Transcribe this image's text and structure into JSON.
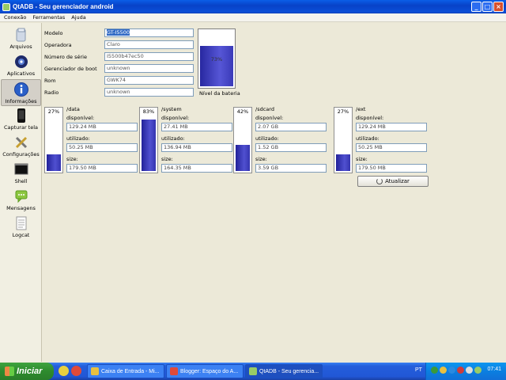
{
  "window": {
    "title": "QtADB - Seu gerenciador android"
  },
  "menu": [
    "Conexão",
    "Ferramentas",
    "Ajuda"
  ],
  "sidebar": {
    "items": [
      {
        "label": "Arquivos",
        "icon": "folder-icon"
      },
      {
        "label": "Aplicativos",
        "icon": "gear-icon"
      },
      {
        "label": "Informações",
        "icon": "info-icon",
        "active": true
      },
      {
        "label": "Capturar tela",
        "icon": "phone-icon"
      },
      {
        "label": "Configurações",
        "icon": "tools-icon"
      },
      {
        "label": "Shell",
        "icon": "terminal-icon"
      },
      {
        "label": "Mensagens",
        "icon": "message-icon"
      },
      {
        "label": "Logcat",
        "icon": "log-icon"
      }
    ]
  },
  "info": {
    "fields": [
      {
        "label": "Modelo",
        "value": "GT-I5500"
      },
      {
        "label": "Operadora",
        "value": "Claro"
      },
      {
        "label": "Número de série",
        "value": "I5500b47ec50"
      },
      {
        "label": "Gerenciador de boot",
        "value": "unknown"
      },
      {
        "label": "Rom",
        "value": "GWK74"
      },
      {
        "label": "Radio",
        "value": "unknown"
      }
    ],
    "battery": {
      "percent_text": "73%",
      "level": 0.73,
      "label": "Nível da bateria"
    }
  },
  "disks": [
    {
      "mount": "/data",
      "percent_text": "27%",
      "used_fraction": 0.27,
      "available_label": "disponível:",
      "available": "129.24 MB",
      "used_label": "utilizado:",
      "used": "50.25 MB",
      "size_label": "size:",
      "size": "179.50 MB"
    },
    {
      "mount": "/system",
      "percent_text": "83%",
      "used_fraction": 0.83,
      "available_label": "disponível:",
      "available": "27.41 MB",
      "used_label": "utilizado:",
      "used": "136.94 MB",
      "size_label": "size:",
      "size": "164.35 MB"
    },
    {
      "mount": "/sdcard",
      "percent_text": "42%",
      "used_fraction": 0.42,
      "available_label": "disponível:",
      "available": "2.07 GB",
      "used_label": "utilizado:",
      "used": "1.52 GB",
      "size_label": "size:",
      "size": "3.59 GB"
    },
    {
      "mount": "/ext",
      "percent_text": "27%",
      "used_fraction": 0.27,
      "available_label": "disponível:",
      "available": "129.24 MB",
      "used_label": "utilizado:",
      "used": "50.25 MB",
      "size_label": "size:",
      "size": "179.50 MB"
    }
  ],
  "refresh_button": {
    "label": "Atualizar"
  },
  "taskbar": {
    "start_label": "Iniciar",
    "tasks": [
      {
        "label": "Caixa de Entrada - Mi..."
      },
      {
        "label": "Blogger: Espaço do A..."
      },
      {
        "label": "QtADB - Seu gerencia...",
        "active": true
      }
    ],
    "language": "PT",
    "clock": "07:41"
  },
  "colors": {
    "titlebar": "#0a4fd8",
    "bar_fill": "#3434b0",
    "taskbar": "#245edb",
    "start": "#2e8b2e"
  }
}
